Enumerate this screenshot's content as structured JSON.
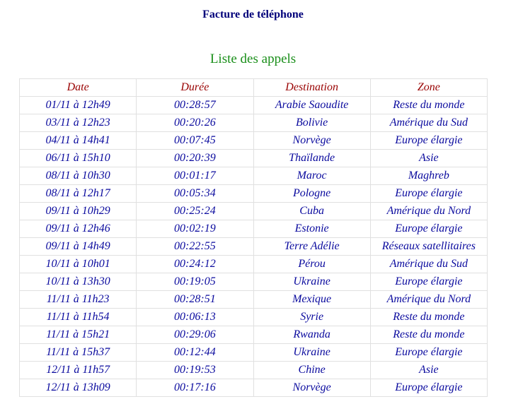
{
  "header": {
    "title": "Facture de téléphone",
    "section_title": "Liste des appels"
  },
  "table": {
    "columns": [
      "Date",
      "Durée",
      "Destination",
      "Zone"
    ],
    "rows": [
      [
        "01/11 à 12h49",
        "00:28:57",
        "Arabie Saoudite",
        "Reste du monde"
      ],
      [
        "03/11 à 12h23",
        "00:20:26",
        "Bolivie",
        "Amérique du Sud"
      ],
      [
        "04/11 à 14h41",
        "00:07:45",
        "Norvège",
        "Europe élargie"
      ],
      [
        "06/11 à 15h10",
        "00:20:39",
        "Thaïlande",
        "Asie"
      ],
      [
        "08/11 à 10h30",
        "00:01:17",
        "Maroc",
        "Maghreb"
      ],
      [
        "08/11 à 12h17",
        "00:05:34",
        "Pologne",
        "Europe élargie"
      ],
      [
        "09/11 à 10h29",
        "00:25:24",
        "Cuba",
        "Amérique du Nord"
      ],
      [
        "09/11 à 12h46",
        "00:02:19",
        "Estonie",
        "Europe élargie"
      ],
      [
        "09/11 à 14h49",
        "00:22:55",
        "Terre Adélie",
        "Réseaux satellitaires"
      ],
      [
        "10/11 à 10h01",
        "00:24:12",
        "Pérou",
        "Amérique du Sud"
      ],
      [
        "10/11 à 13h30",
        "00:19:05",
        "Ukraine",
        "Europe élargie"
      ],
      [
        "11/11 à 11h23",
        "00:28:51",
        "Mexique",
        "Amérique du Nord"
      ],
      [
        "11/11 à 11h54",
        "00:06:13",
        "Syrie",
        "Reste du monde"
      ],
      [
        "11/11 à 15h21",
        "00:29:06",
        "Rwanda",
        "Reste du monde"
      ],
      [
        "11/11 à 15h37",
        "00:12:44",
        "Ukraine",
        "Europe élargie"
      ],
      [
        "12/11 à 11h57",
        "00:19:53",
        "Chine",
        "Asie"
      ],
      [
        "12/11 à 13h09",
        "00:17:16",
        "Norvège",
        "Europe élargie"
      ]
    ]
  },
  "colors": {
    "title": "#00007a",
    "section_title": "#1a8f1a",
    "header_text": "#990000",
    "cell_text": "#0a0a9e",
    "grid": "#e0e0e0"
  }
}
